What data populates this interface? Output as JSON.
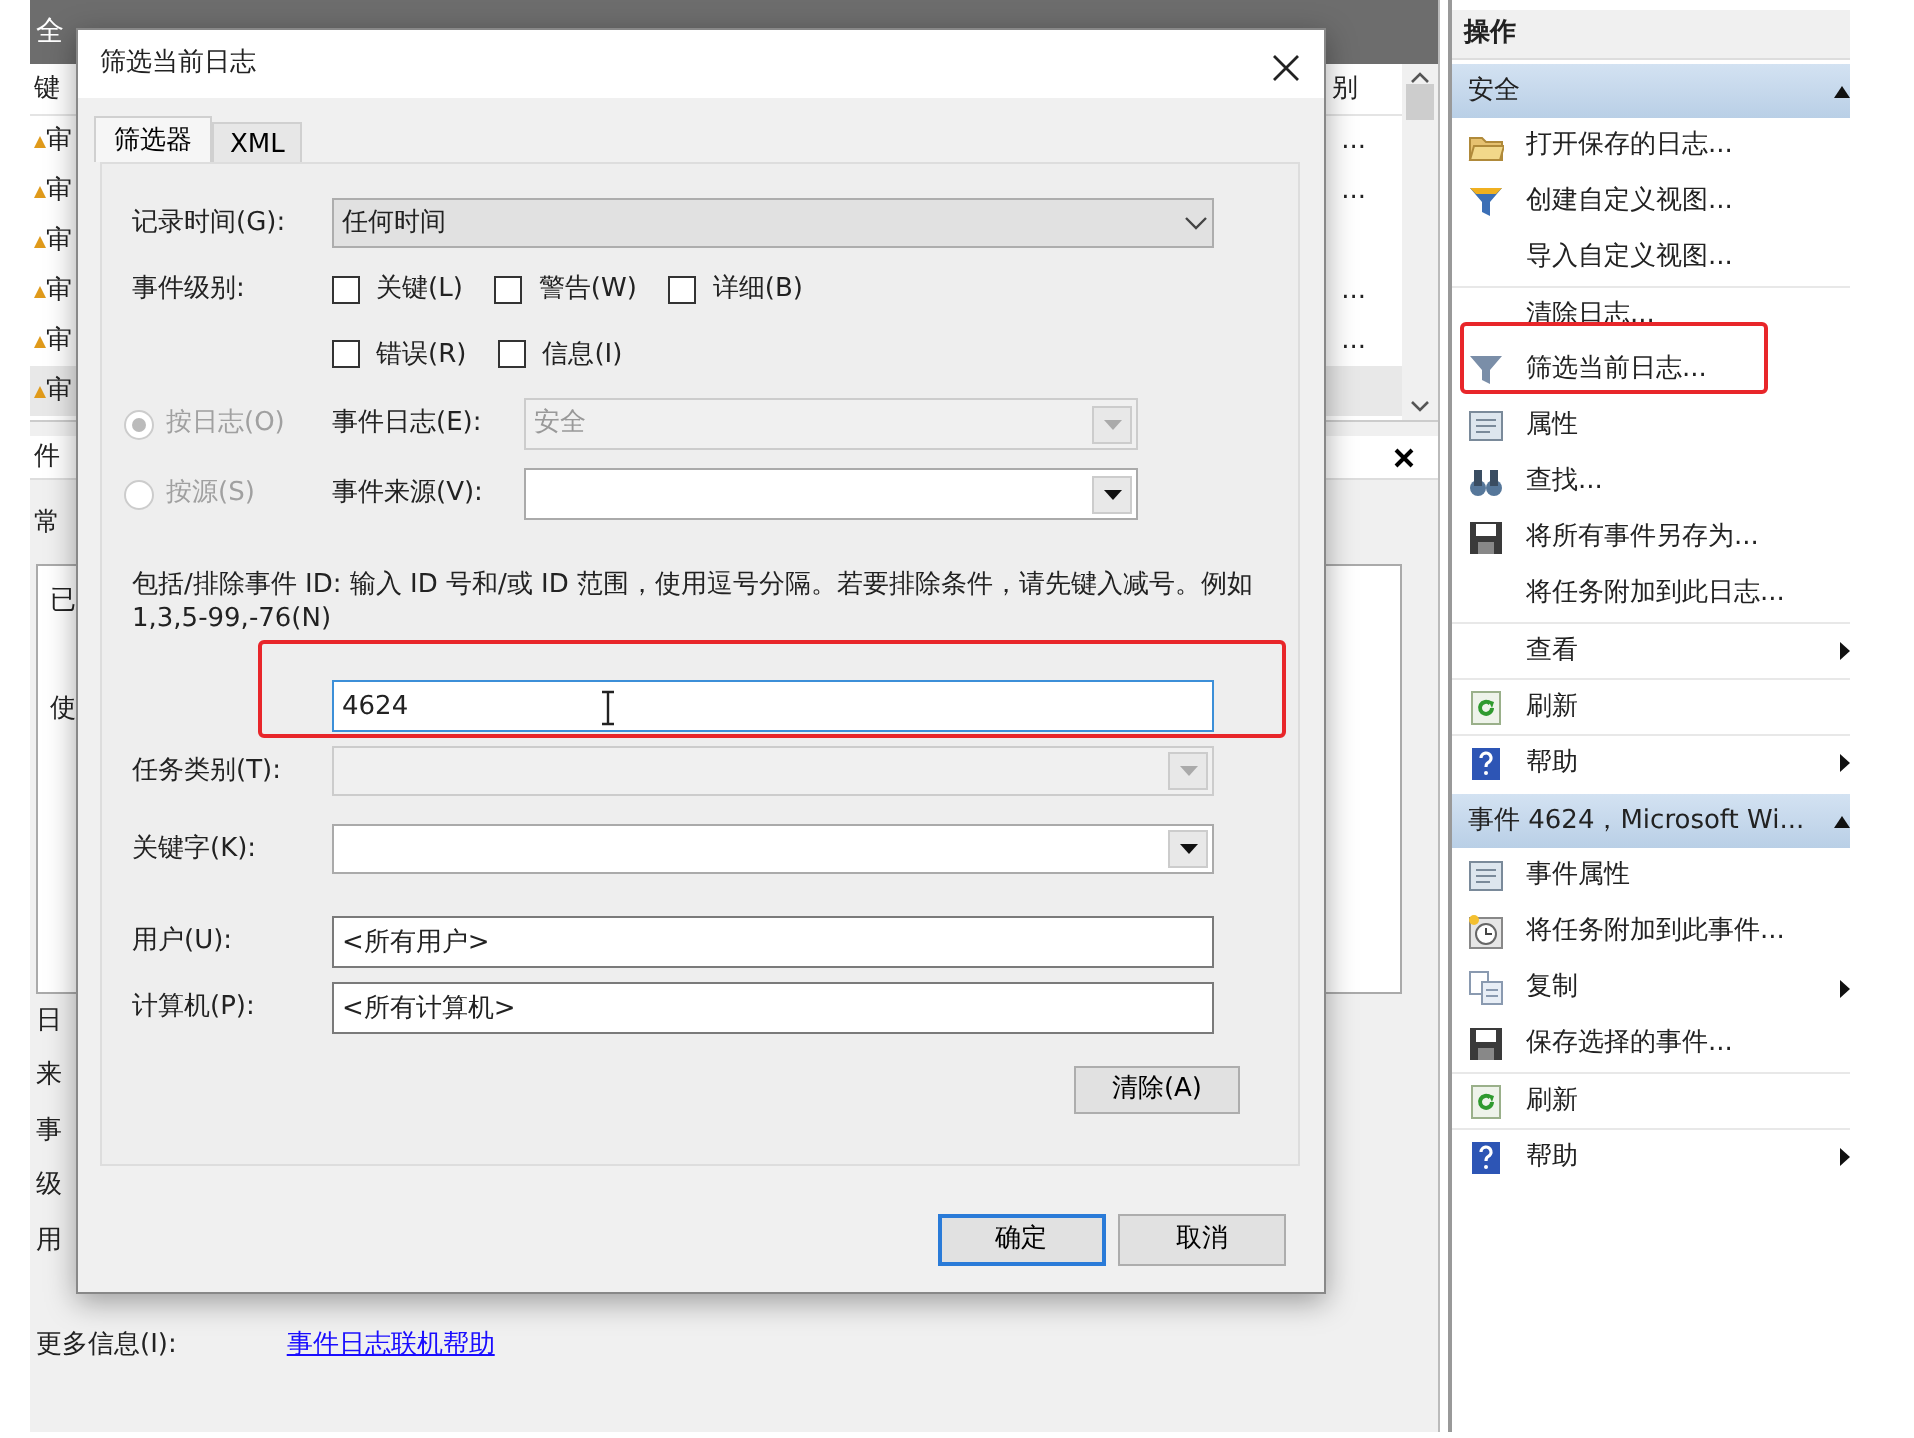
{
  "background": {
    "header": "全",
    "list": {
      "columns": [
        "键",
        "别"
      ],
      "rows": [
        {
          "name": "审",
          "more": "..."
        },
        {
          "name": "审",
          "more": "..."
        },
        {
          "name": "审"
        },
        {
          "name": "审",
          "more": "..."
        },
        {
          "name": "审",
          "more": "..."
        },
        {
          "name": "审"
        }
      ]
    },
    "details": {
      "title": "件",
      "tab": "常",
      "box_lines": [
        "已",
        "使"
      ],
      "field_labels": [
        "日",
        "来",
        "事",
        "级",
        "用"
      ],
      "more_info": {
        "label": "更多信息(I):",
        "link": "事件日志联机帮助"
      }
    }
  },
  "dialog": {
    "title": "筛选当前日志",
    "tabs": [
      {
        "label": "筛选器",
        "selected": true
      },
      {
        "label": "XML",
        "selected": false
      }
    ],
    "logged": {
      "label": "记录时间(G):",
      "value": "任何时间"
    },
    "event_level": {
      "label": "事件级别:",
      "rows": [
        {
          "options": [
            {
              "label": "关键(L)",
              "checked": false
            },
            {
              "label": "警告(W)",
              "checked": false
            },
            {
              "label": "详细(B)",
              "checked": false
            }
          ]
        },
        {
          "options": [
            {
              "label": "错误(R)",
              "checked": false
            },
            {
              "label": "信息(I)",
              "checked": false
            }
          ]
        }
      ]
    },
    "sources": [
      {
        "label": "按日志(O)",
        "selected": true,
        "disabled": true,
        "field_label": "事件日志(E):",
        "value": "安全",
        "field_disabled": true
      },
      {
        "label": "按源(S)",
        "selected": false,
        "disabled": true,
        "field_label": "事件来源(V):",
        "field_disabled": false
      }
    ],
    "event_id": {
      "hint": "包括/排除事件 ID: 输入 ID 号和/或 ID 范围，使用逗号分隔。若要排除条件，请先键入减号。例如 1,3,5-99,-76(N)",
      "value": "4624",
      "highlighted": true
    },
    "fields": [
      {
        "label": "任务类别(T):",
        "kind": "dropdown",
        "disabled": true
      },
      {
        "label": "关键字(K):",
        "kind": "dropdown",
        "disabled": false
      },
      {
        "label": "用户(U):",
        "kind": "text",
        "value": "<所有用户>"
      },
      {
        "label": "计算机(P):",
        "kind": "text",
        "value": "<所有计算机>"
      }
    ],
    "clear_button": "清除(A)",
    "buttons": [
      {
        "label": "确定",
        "default": true
      },
      {
        "label": "取消",
        "default": false
      }
    ]
  },
  "actions": {
    "title": "操作",
    "sections": [
      {
        "title": "安全",
        "items": [
          {
            "label": "打开保存的日志...",
            "kind": "folder"
          },
          {
            "label": "创建自定义视图...",
            "kind": "filter"
          },
          {
            "label": "导入自定义视图..."
          },
          {
            "label": "清除日志...",
            "separator_before": true
          },
          {
            "label": "筛选当前日志...",
            "kind": "funnel",
            "highlighted": true
          },
          {
            "label": "属性",
            "kind": "properties"
          },
          {
            "label": "查找...",
            "kind": "binoculars"
          },
          {
            "label": "将所有事件另存为...",
            "kind": "save"
          },
          {
            "label": "将任务附加到此日志..."
          },
          {
            "label": "查看",
            "separator_before": true,
            "submenu": true
          },
          {
            "label": "刷新",
            "kind": "refresh",
            "separator_before": true
          },
          {
            "label": "帮助",
            "kind": "help",
            "separator_before": true,
            "submenu": true
          }
        ]
      },
      {
        "title": "事件 4624，Microsoft Wi...",
        "items": [
          {
            "label": "事件属性",
            "kind": "properties"
          },
          {
            "label": "将任务附加到此事件...",
            "kind": "clock"
          },
          {
            "label": "复制",
            "kind": "copy",
            "submenu": true
          },
          {
            "label": "保存选择的事件...",
            "kind": "save"
          },
          {
            "label": "刷新",
            "kind": "refresh",
            "separator_before": true
          },
          {
            "label": "帮助",
            "kind": "help",
            "separator_before": true,
            "submenu": true
          }
        ]
      }
    ]
  }
}
